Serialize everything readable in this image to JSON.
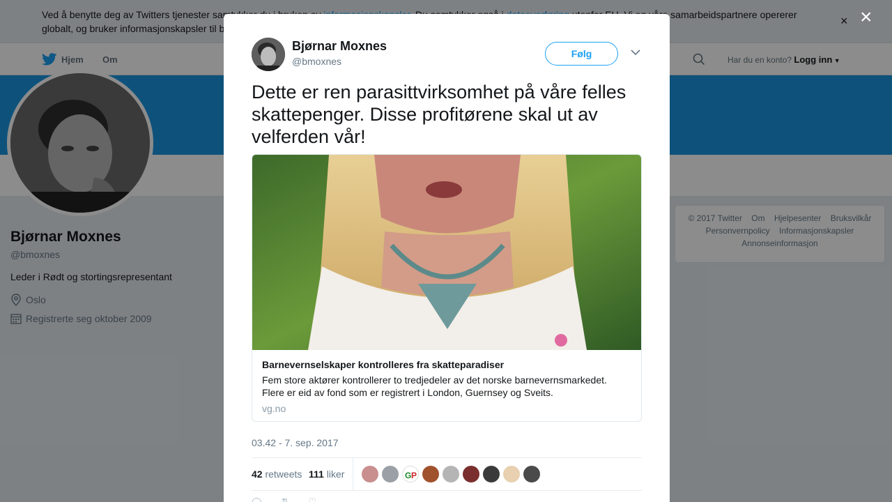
{
  "cookie": {
    "text_1": "Ved å benytte deg av Twitters tjenester samtykker du i bruken av ",
    "link_1": "informasjonskapsler",
    "text_2": ". Du samtykker også i ",
    "link_2": "dataoverføring",
    "text_3": " utenfor EU. Vi og våre samarbeidspartnere opererer globalt, og bruker informasjonskapsler til blant annet analyse, tilpasning og annonsering.",
    "close": "×"
  },
  "nav": {
    "home": "Hjem",
    "about": "Om",
    "account_prompt": "Har du en konto?",
    "login": "Logg inn"
  },
  "profile": {
    "name": "Bjørnar Moxnes",
    "handle": "@bmoxnes",
    "bio": "Leder i Rødt og stortingsrepresentant",
    "location": "Oslo",
    "joined": "Registrerte seg oktober 2009"
  },
  "footer": {
    "links": [
      "© 2017 Twitter",
      "Om",
      "Hjelpesenter",
      "Bruksvilkår",
      "Personvernpolicy",
      "Informasjonskapsler",
      "Annonseinformasjon"
    ]
  },
  "modal": {
    "close": "×",
    "name": "Bjørnar Moxnes",
    "handle": "@bmoxnes",
    "follow": "Følg",
    "text": "Dette er ren parasittvirksomhet på våre felles skattepenger. Disse profitørene skal ut av velferden vår!",
    "card": {
      "title": "Barnevernselskaper kontrolleres fra skatteparadiser",
      "description": "Fem store aktører kontrollerer to tredjedeler av det norske barnevernsmarkedet. Flere er eid av fond som er registrert i London, Guernsey og Sveits.",
      "domain": "vg.no"
    },
    "timestamp": "03.42 - 7. sep. 2017",
    "retweets_count": "42",
    "retweets_label": "retweets",
    "likes_count": "111",
    "likes_label": "liker"
  },
  "colors": {
    "accent": "#1da1f2",
    "cover": "#1b95e0",
    "background": "#e6ecf0"
  }
}
